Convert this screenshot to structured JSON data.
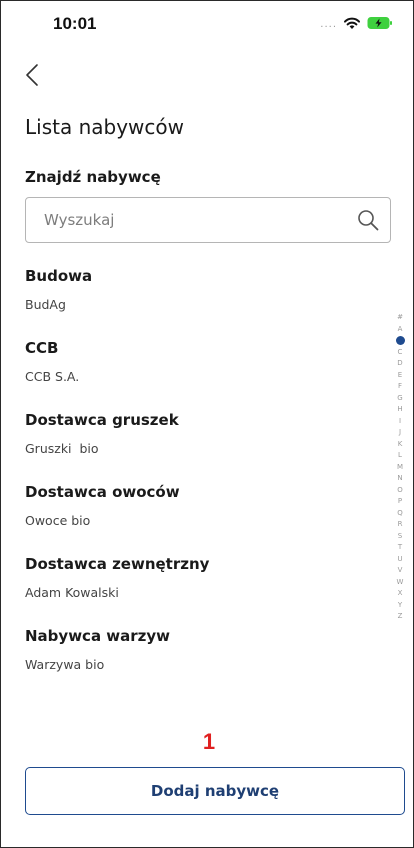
{
  "status_bar": {
    "time": "10:01",
    "signal_dots": "....",
    "icons": [
      "wifi-icon",
      "battery-charging-icon"
    ],
    "battery_color": "#3fd13f"
  },
  "nav": {
    "back_icon": "chevron-left-icon"
  },
  "page": {
    "title": "Lista nabywców"
  },
  "search": {
    "label": "Znajdź nabywcę",
    "placeholder": "Wyszukaj",
    "value": "",
    "icon": "search-icon"
  },
  "buyers": [
    {
      "name": "Budowa",
      "subtitle": "BudAg"
    },
    {
      "name": "CCB",
      "subtitle": "CCB S.A."
    },
    {
      "name": "Dostawca gruszek",
      "subtitle": "Gruszki  bio"
    },
    {
      "name": "Dostawca owoców",
      "subtitle": "Owoce bio"
    },
    {
      "name": "Dostawca zewnętrzny",
      "subtitle": "Adam Kowalski"
    },
    {
      "name": "Nabywca warzyw",
      "subtitle": "Warzywa bio"
    }
  ],
  "alphabet_index": {
    "letters": [
      "#",
      "A",
      "B",
      "C",
      "D",
      "E",
      "F",
      "G",
      "H",
      "I",
      "J",
      "K",
      "L",
      "M",
      "N",
      "O",
      "P",
      "Q",
      "R",
      "S",
      "T",
      "U",
      "V",
      "W",
      "X",
      "Y",
      "Z"
    ],
    "active": "B"
  },
  "annotation": {
    "marker": "1",
    "color": "#e02020"
  },
  "actions": {
    "add_buyer_label": "Dodaj nabywcę"
  },
  "theme": {
    "accent": "#1f4b8f"
  }
}
